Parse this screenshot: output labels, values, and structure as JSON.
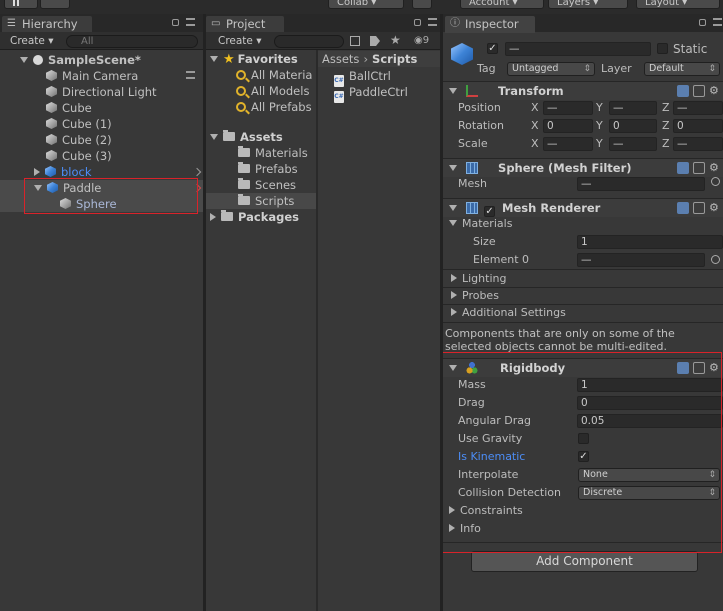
{
  "toolbar": {
    "collab": "Collab ▾",
    "account": "Account ▾",
    "layers": "Layers ▾",
    "layout": "Layout ▾"
  },
  "hierarchy": {
    "tab": "Hierarchy",
    "create": "Create ▾",
    "search_placeholder": "All",
    "scene": "SampleScene*",
    "items": [
      "Main Camera",
      "Directional Light",
      "Cube",
      "Cube (1)",
      "Cube (2)",
      "Cube (3)",
      "block",
      "Paddle",
      "Sphere"
    ]
  },
  "project": {
    "tab": "Project",
    "create": "Create ▾",
    "count": "9",
    "favorites": {
      "label": "Favorites",
      "items": [
        "All Materia",
        "All Models",
        "All Prefabs"
      ]
    },
    "assets": {
      "label": "Assets",
      "folders": [
        "Materials",
        "Prefabs",
        "Scenes",
        "Scripts"
      ]
    },
    "packages": "Packages",
    "breadcrumb": [
      "Assets",
      "Scripts"
    ],
    "files": [
      "BallCtrl",
      "PaddleCtrl"
    ]
  },
  "inspector": {
    "tab": "Inspector",
    "name_value": "—",
    "static_label": "Static",
    "tag_label": "Tag",
    "tag_value": "Untagged",
    "layer_label": "Layer",
    "layer_value": "Default",
    "transform": {
      "title": "Transform",
      "rows": [
        {
          "label": "Position",
          "x": "—",
          "y": "—",
          "z": "—"
        },
        {
          "label": "Rotation",
          "x": "0",
          "y": "0",
          "z": "0"
        },
        {
          "label": "Scale",
          "x": "—",
          "y": "—",
          "z": "—"
        }
      ],
      "axis": [
        "X",
        "Y",
        "Z"
      ]
    },
    "mesh_filter": {
      "title": "Sphere (Mesh Filter)",
      "mesh_label": "Mesh",
      "mesh_value": "—"
    },
    "mesh_renderer": {
      "title": "Mesh Renderer",
      "materials": "Materials",
      "size_label": "Size",
      "size_value": "1",
      "element_label": "Element 0",
      "element_value": "—",
      "lighting": "Lighting",
      "probes": "Probes",
      "additional": "Additional Settings"
    },
    "note": "Components that are only on some of the selected objects cannot be multi-edited.",
    "rigidbody": {
      "title": "Rigidbody",
      "mass_label": "Mass",
      "mass_value": "1",
      "drag_label": "Drag",
      "drag_value": "0",
      "angular_label": "Angular Drag",
      "angular_value": "0.05",
      "gravity_label": "Use Gravity",
      "kinematic_label": "Is Kinematic",
      "interp_label": "Interpolate",
      "interp_value": "None",
      "collision_label": "Collision Detection",
      "collision_value": "Discrete",
      "constraints": "Constraints",
      "info": "Info"
    },
    "add_component": "Add Component"
  },
  "colors": {
    "highlight": "#d9232a",
    "link_blue": "#4c8df6",
    "selected_row": "#4a4a4a"
  }
}
